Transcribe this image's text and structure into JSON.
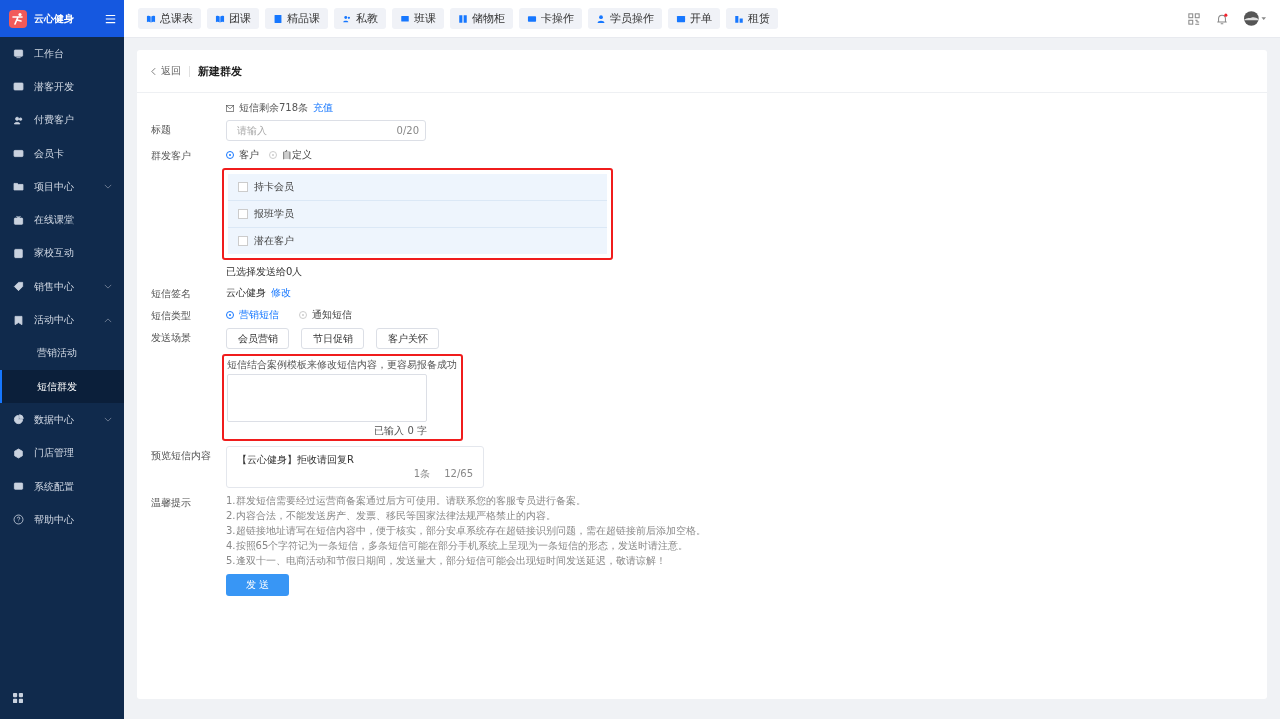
{
  "app": {
    "name": "云心健身"
  },
  "sidebar": {
    "items": [
      {
        "label": "工作台",
        "kind": "link",
        "selected": false
      },
      {
        "label": "潜客开发",
        "kind": "link",
        "selected": false
      },
      {
        "label": "付费客户",
        "kind": "link",
        "selected": false
      },
      {
        "label": "会员卡",
        "kind": "link",
        "selected": false
      },
      {
        "label": "项目中心",
        "kind": "group",
        "expanded": false,
        "selected": false
      },
      {
        "label": "在线课堂",
        "kind": "link",
        "selected": false
      },
      {
        "label": "家校互动",
        "kind": "link",
        "selected": false
      },
      {
        "label": "销售中心",
        "kind": "group",
        "expanded": false,
        "selected": false
      },
      {
        "label": "活动中心",
        "kind": "group",
        "expanded": true,
        "selected": false,
        "children": [
          {
            "label": "营销活动",
            "selected": false
          },
          {
            "label": "短信群发",
            "selected": true
          }
        ]
      },
      {
        "label": "数据中心",
        "kind": "group",
        "expanded": false,
        "selected": false
      },
      {
        "label": "门店管理",
        "kind": "link",
        "selected": false
      },
      {
        "label": "系统配置",
        "kind": "link",
        "selected": false
      },
      {
        "label": "帮助中心",
        "kind": "link",
        "selected": false
      }
    ]
  },
  "top_tabs": [
    {
      "label": "总课表"
    },
    {
      "label": "团课"
    },
    {
      "label": "精品课"
    },
    {
      "label": "私教"
    },
    {
      "label": "班课"
    },
    {
      "label": "储物柜"
    },
    {
      "label": "卡操作"
    },
    {
      "label": "学员操作"
    },
    {
      "label": "开单"
    },
    {
      "label": "租赁"
    }
  ],
  "header": {
    "notifications_unread": true
  },
  "page": {
    "back": "返回",
    "title": "新建群发",
    "sms_balance": "短信剩余718条",
    "recharge": "充值",
    "title_field": {
      "label": "标题",
      "placeholder": "请输入",
      "counter": "0/20"
    },
    "recipients": {
      "label": "群发客户",
      "options": [
        {
          "label": "客户",
          "selected": true
        },
        {
          "label": "自定义",
          "selected": false
        }
      ],
      "groups": [
        {
          "label": "持卡会员",
          "checked": false
        },
        {
          "label": "报班学员",
          "checked": false
        },
        {
          "label": "潜在客户",
          "checked": false
        }
      ],
      "summary": "已选择发送给0人"
    },
    "signature": {
      "label": "短信签名",
      "value": "云心健身",
      "action": "修改"
    },
    "sms_type": {
      "label": "短信类型",
      "options": [
        {
          "label": "营销短信",
          "selected": true
        },
        {
          "label": "通知短信",
          "selected": false
        }
      ]
    },
    "scenes": {
      "label": "发送场景",
      "buttons": [
        "会员营销",
        "节日促销",
        "客户关怀"
      ]
    },
    "content": {
      "hint": "短信结合案例模板来修改短信内容，更容易报备成功",
      "counter": "已输入 0 字"
    },
    "preview": {
      "label": "预览短信内容",
      "text": "【云心健身】拒收请回复R",
      "count": "1条",
      "length": "12/65"
    },
    "tips": {
      "label": "温馨提示",
      "lines": [
        "1.群发短信需要经过运营商备案通过后方可使用。请联系您的客服专员进行备案。",
        "2.内容合法，不能发送房产、发票、移民等国家法律法规严格禁止的内容。",
        "3.超链接地址请写在短信内容中，便于核实，部分安卓系统存在超链接识别问题，需在超链接前后添加空格。",
        "4.按照65个字符记为一条短信，多条短信可能在部分手机系统上呈现为一条短信的形态，发送时请注意。",
        "5.逢双十一、电商活动和节假日期间，发送量大，部分短信可能会出现短时间发送延迟，敬请谅解！"
      ]
    },
    "submit": "发 送"
  }
}
